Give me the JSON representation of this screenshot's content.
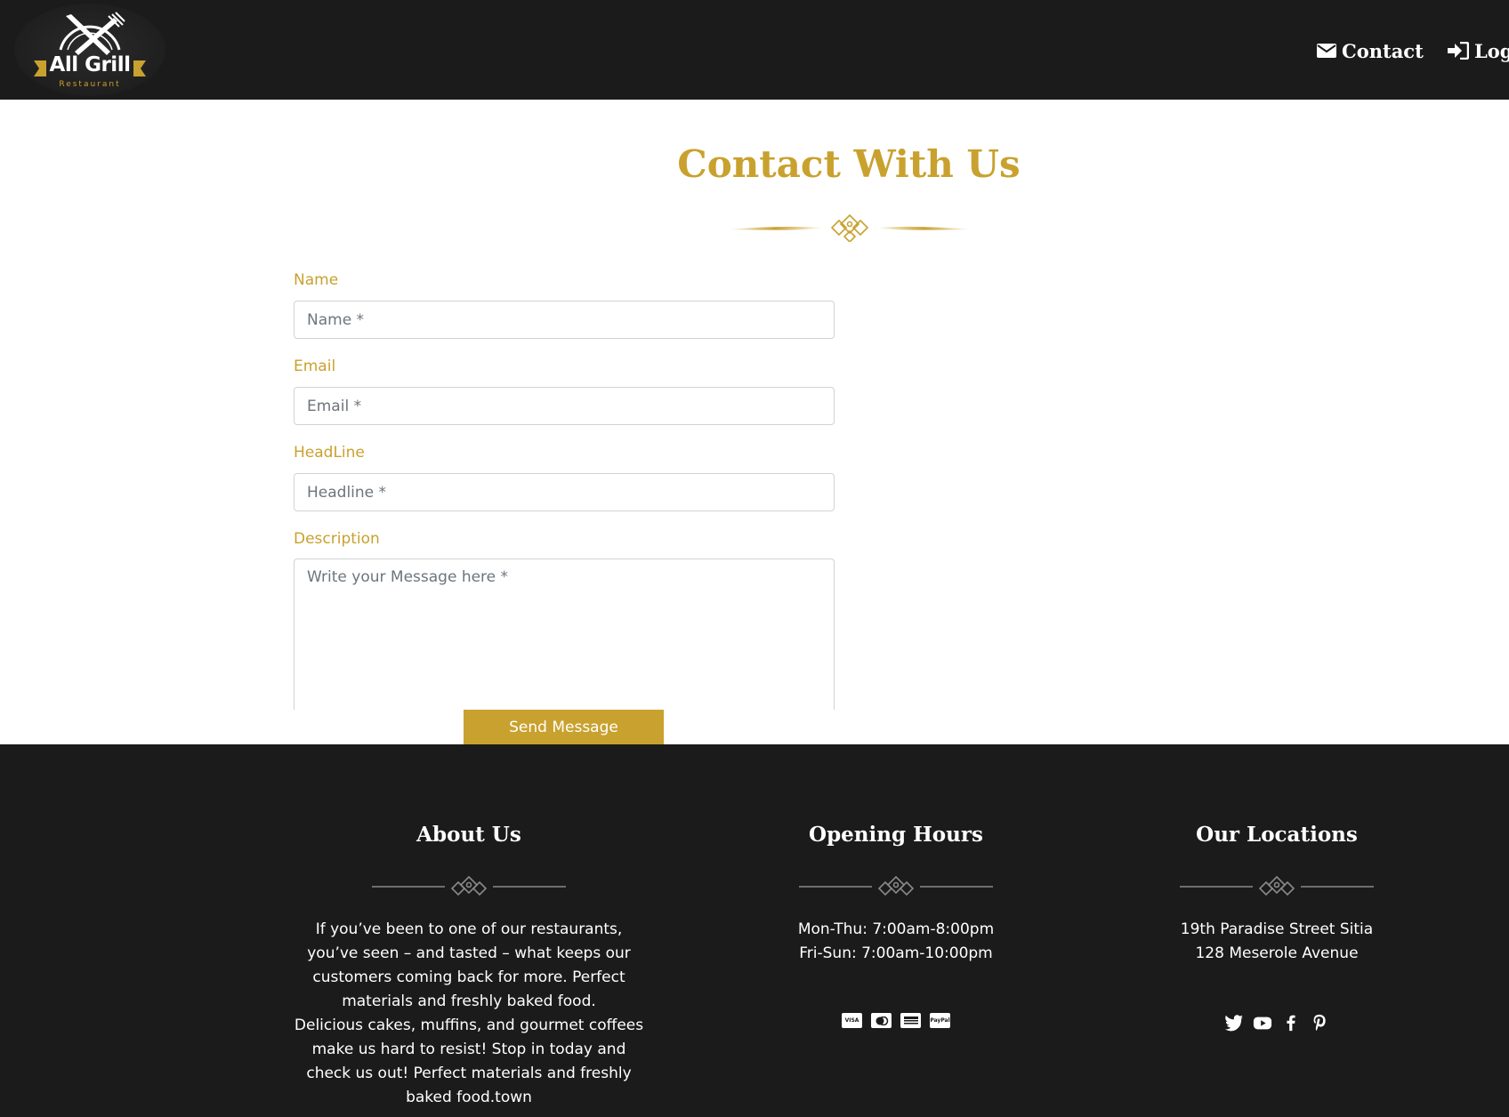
{
  "header": {
    "logo": {
      "name": "All Grill",
      "subtitle": "Restaurant"
    },
    "nav": [
      {
        "label": "Contact",
        "icon": "envelope-icon"
      },
      {
        "label": "Login",
        "icon": "sign-in-icon"
      }
    ]
  },
  "contact_form": {
    "title": "Contact With Us",
    "fields": {
      "name": {
        "label": "Name",
        "placeholder": "Name *",
        "value": ""
      },
      "email": {
        "label": "Email",
        "placeholder": "Email *",
        "value": ""
      },
      "headline": {
        "label": "HeadLine",
        "placeholder": "Headline *",
        "value": ""
      },
      "description": {
        "label": "Description",
        "placeholder": "Write your Message here *",
        "value": ""
      }
    },
    "submit_label": "Send Message"
  },
  "footer": {
    "about": {
      "heading": "About Us",
      "paragraphs": [
        "If you’ve been to one of our restaurants, you’ve seen – and tasted – what keeps our customers coming back for more. Perfect materials and freshly baked food.",
        "Delicious cakes, muffins, and gourmet coffees make us hard to resist! Stop in today and check us out! Perfect materials and freshly baked food.town"
      ]
    },
    "hours": {
      "heading": "Opening Hours",
      "lines": [
        "Mon-Thu: 7:00am-8:00pm",
        "Fri-Sun: 7:00am-10:00pm"
      ],
      "payment_icons": [
        "visa-icon",
        "mastercard-icon",
        "amex-icon",
        "paypal-icon"
      ]
    },
    "locations": {
      "heading": "Our Locations",
      "lines": [
        "19th Paradise Street Sitia",
        "128 Meserole Avenue"
      ],
      "social_icons": [
        "twitter-icon",
        "youtube-icon",
        "facebook-icon",
        "pinterest-icon"
      ]
    }
  },
  "colors": {
    "accent_gold": "#c9a12e",
    "dark_background": "#1b1b1b",
    "white": "#ffffff",
    "ornament_gray": "#8a8a8a"
  }
}
